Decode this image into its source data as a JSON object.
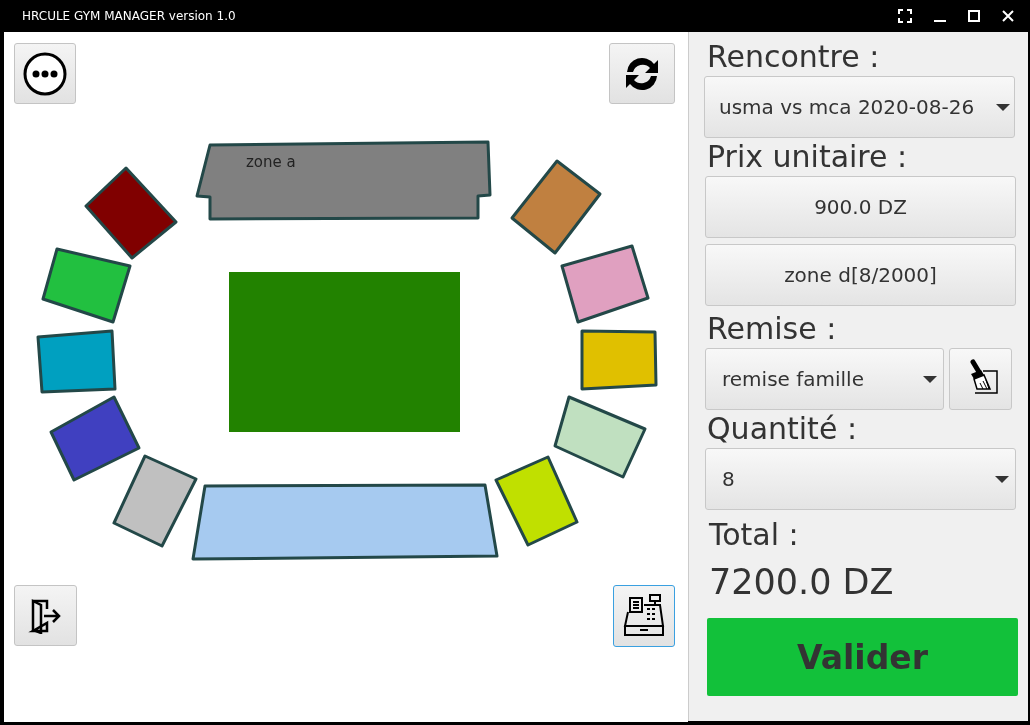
{
  "window": {
    "title": "HRCULE GYM MANAGER version 1.0"
  },
  "zones": [
    {
      "label": "zone a",
      "color": "#808080"
    },
    {
      "color": "#800000"
    },
    {
      "color": "#c08040"
    },
    {
      "color": "#22c040"
    },
    {
      "color": "#e0a0c0"
    },
    {
      "color": "#00a0c0"
    },
    {
      "color": "#e0c000"
    },
    {
      "color": "#4040c0"
    },
    {
      "color": "#c0e0c0"
    },
    {
      "color": "#c0c0c0"
    },
    {
      "color": "#c0e000"
    },
    {
      "color": "#a6caf0"
    }
  ],
  "panel": {
    "match_label": "Rencontre :",
    "match_value": "usma vs mca 2020-08-26",
    "price_label": "Prix unitaire :",
    "price_value": "900.0 DZ",
    "zone_value": "zone d[8/2000]",
    "discount_label": "Remise :",
    "discount_value": "remise famille",
    "quantity_label": "Quantité :",
    "quantity_value": "8",
    "total_label": "Total :",
    "total_value": "7200.0 DZ",
    "submit": "Valider"
  }
}
